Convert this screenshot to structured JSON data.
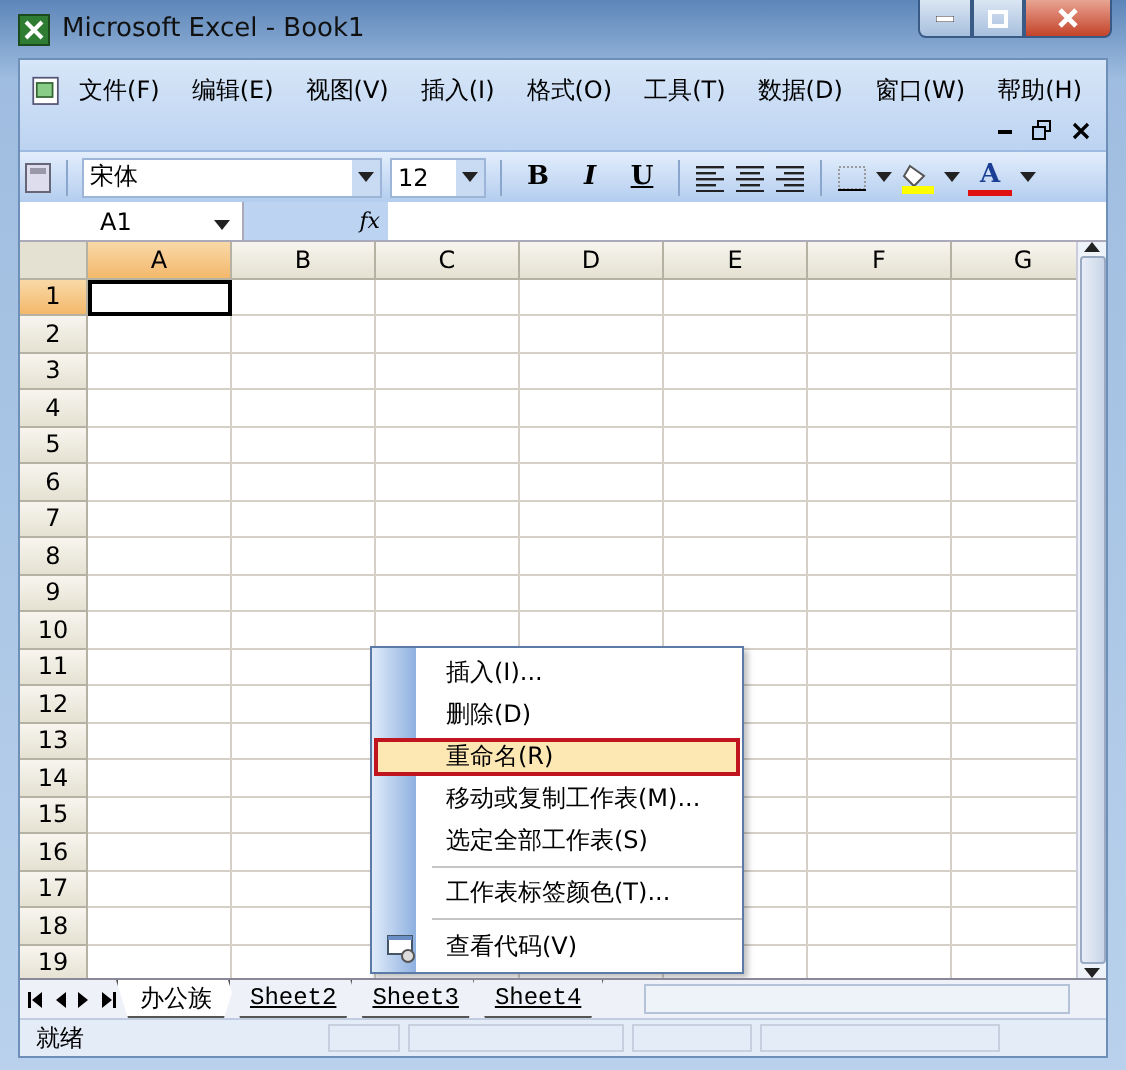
{
  "window": {
    "title": "Microsoft Excel - Book1"
  },
  "menu": [
    "文件(F)",
    "编辑(E)",
    "视图(V)",
    "插入(I)",
    "格式(O)",
    "工具(T)",
    "数据(D)",
    "窗口(W)",
    "帮助(H)"
  ],
  "toolbar": {
    "font": "宋体",
    "size": "12",
    "style_buttons": [
      "B",
      "I",
      "U"
    ],
    "font_color": "A"
  },
  "formula_bar": {
    "name_box": "A1",
    "function_label": "fx"
  },
  "columns": [
    {
      "label": "A",
      "selected": true
    },
    {
      "label": "B",
      "selected": false
    },
    {
      "label": "C",
      "selected": false
    },
    {
      "label": "D",
      "selected": false
    },
    {
      "label": "E",
      "selected": false
    },
    {
      "label": "F",
      "selected": false
    },
    {
      "label": "G",
      "selected": false
    }
  ],
  "rows": [
    {
      "label": "1",
      "selected": true
    },
    {
      "label": "2",
      "selected": false
    },
    {
      "label": "3",
      "selected": false
    },
    {
      "label": "4",
      "selected": false
    },
    {
      "label": "5",
      "selected": false
    },
    {
      "label": "6",
      "selected": false
    },
    {
      "label": "7",
      "selected": false
    },
    {
      "label": "8",
      "selected": false
    },
    {
      "label": "9",
      "selected": false
    },
    {
      "label": "10",
      "selected": false
    },
    {
      "label": "11",
      "selected": false
    },
    {
      "label": "12",
      "selected": false
    },
    {
      "label": "13",
      "selected": false
    },
    {
      "label": "14",
      "selected": false
    },
    {
      "label": "15",
      "selected": false
    },
    {
      "label": "16",
      "selected": false
    },
    {
      "label": "17",
      "selected": false
    },
    {
      "label": "18",
      "selected": false
    },
    {
      "label": "19",
      "selected": false
    }
  ],
  "sheet_tabs": [
    {
      "label": "办公族",
      "selected": true
    },
    {
      "label": "Sheet2",
      "selected": false
    },
    {
      "label": "Sheet3",
      "selected": false
    },
    {
      "label": "Sheet4",
      "selected": false
    }
  ],
  "context_menu": {
    "groups": [
      [
        {
          "label": "插入(I)...",
          "selected": false,
          "kind": "plain"
        },
        {
          "label": "删除(D)",
          "selected": false,
          "kind": "plain"
        },
        {
          "label": "重命名(R)",
          "selected": true,
          "kind": "plain"
        },
        {
          "label": "移动或复制工作表(M)...",
          "selected": false,
          "kind": "plain"
        },
        {
          "label": "选定全部工作表(S)",
          "selected": false,
          "kind": "plain"
        }
      ],
      [
        {
          "label": "工作表标签颜色(T)...",
          "selected": false,
          "kind": "plain"
        }
      ],
      [
        {
          "label": "查看代码(V)",
          "selected": false,
          "kind": "icon"
        }
      ]
    ]
  },
  "status_bar": {
    "text": "就绪"
  }
}
